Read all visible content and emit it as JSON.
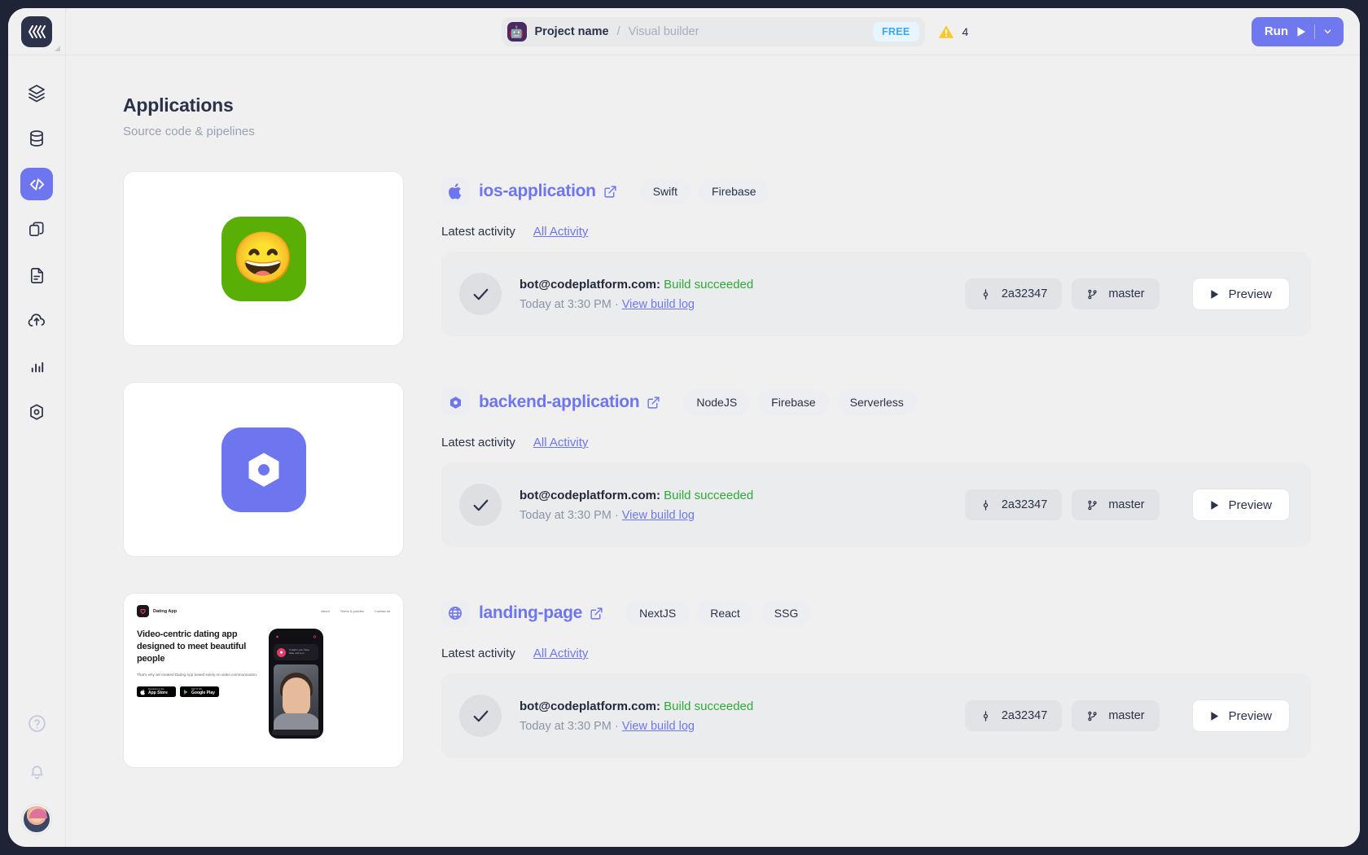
{
  "window": {
    "accent_color": "#6e76ef",
    "background": "#f0f0f1"
  },
  "topbar": {
    "project_icon": "robot-icon",
    "project_name": "Project name",
    "separator": "/",
    "breadcrumb_sub": "Visual builder",
    "plan_badge": "FREE",
    "warning_icon": "warning-triangle-icon",
    "warning_count": "4",
    "run_label": "Run",
    "run_play_icon": "play-icon",
    "run_dropdown_icon": "chevron-down-icon"
  },
  "sidebar": {
    "logo": "brackets-logo-icon",
    "items": [
      {
        "name": "layers-icon",
        "label": "Layers",
        "active": false
      },
      {
        "name": "database-icon",
        "label": "Database",
        "active": false
      },
      {
        "name": "code-icon",
        "label": "Code",
        "active": true
      },
      {
        "name": "copy-icon",
        "label": "Pages",
        "active": false
      },
      {
        "name": "document-icon",
        "label": "Documents",
        "active": false
      },
      {
        "name": "cloud-upload-icon",
        "label": "Deploy",
        "active": false
      },
      {
        "name": "chart-bar-icon",
        "label": "Analytics",
        "active": false
      },
      {
        "name": "hexagon-target-icon",
        "label": "Settings",
        "active": false
      }
    ],
    "bottom": [
      {
        "name": "help-circle-icon",
        "label": "Help"
      },
      {
        "name": "bell-icon",
        "label": "Notifications"
      },
      {
        "name": "avatar",
        "label": "Account"
      }
    ]
  },
  "page": {
    "title": "Applications",
    "subtitle": "Source code & pipelines"
  },
  "labels": {
    "latest_activity": "Latest activity",
    "all_activity": "All Activity",
    "preview": "Preview",
    "view_build_log": "View build log"
  },
  "applications": [
    {
      "name": "ios-application",
      "icon": "apple-icon",
      "external_link_icon": "external-link-icon",
      "tags": [
        "Swift",
        "Firebase"
      ],
      "thumbnail": {
        "type": "app-icon",
        "style": "green",
        "glyph": "😄"
      },
      "activity": {
        "status_icon": "check-icon",
        "user": "bot@codeplatform.com:",
        "result": "Build succeeded",
        "result_color": "#2fa939",
        "timestamp": "Today at 3:30 PM",
        "separator": "·",
        "log_link": "View build log",
        "commit_icon": "commit-icon",
        "commit": "2a32347",
        "branch_icon": "branch-icon",
        "branch": "master",
        "preview_icon": "play-icon",
        "preview": "Preview"
      }
    },
    {
      "name": "backend-application",
      "icon": "hexagon-icon",
      "external_link_icon": "external-link-icon",
      "tags": [
        "NodeJS",
        "Firebase",
        "Serverless"
      ],
      "thumbnail": {
        "type": "app-icon",
        "style": "purple",
        "glyph": "hexagon"
      },
      "activity": {
        "status_icon": "check-icon",
        "user": "bot@codeplatform.com:",
        "result": "Build succeeded",
        "result_color": "#2fa939",
        "timestamp": "Today at 3:30 PM",
        "separator": "·",
        "log_link": "View build log",
        "commit_icon": "commit-icon",
        "commit": "2a32347",
        "branch_icon": "branch-icon",
        "branch": "master",
        "preview_icon": "play-icon",
        "preview": "Preview"
      }
    },
    {
      "name": "landing-page",
      "icon": "globe-icon",
      "external_link_icon": "external-link-icon",
      "tags": [
        "NextJS",
        "React",
        "SSG"
      ],
      "thumbnail": {
        "type": "site-preview",
        "brand": "Dating App",
        "nav": [
          "About",
          "Terms & policies",
          "Contact us"
        ],
        "heading": "Video-centric dating app designed to meet beautiful people",
        "paragraph": "That's why we created Dating App based solely on video communication.",
        "store_badges": [
          {
            "small": "Download on the",
            "large": "App Store"
          },
          {
            "small": "GET IT ON",
            "large": "Google Play"
          }
        ],
        "phone_card": "Tonight's your Video Date, and so is"
      },
      "activity": {
        "status_icon": "check-icon",
        "user": "bot@codeplatform.com:",
        "result": "Build succeeded",
        "result_color": "#2fa939",
        "timestamp": "Today at 3:30 PM",
        "separator": "·",
        "log_link": "View build log",
        "commit_icon": "commit-icon",
        "commit": "2a32347",
        "branch_icon": "branch-icon",
        "branch": "master",
        "preview_icon": "play-icon",
        "preview": "Preview"
      }
    }
  ]
}
